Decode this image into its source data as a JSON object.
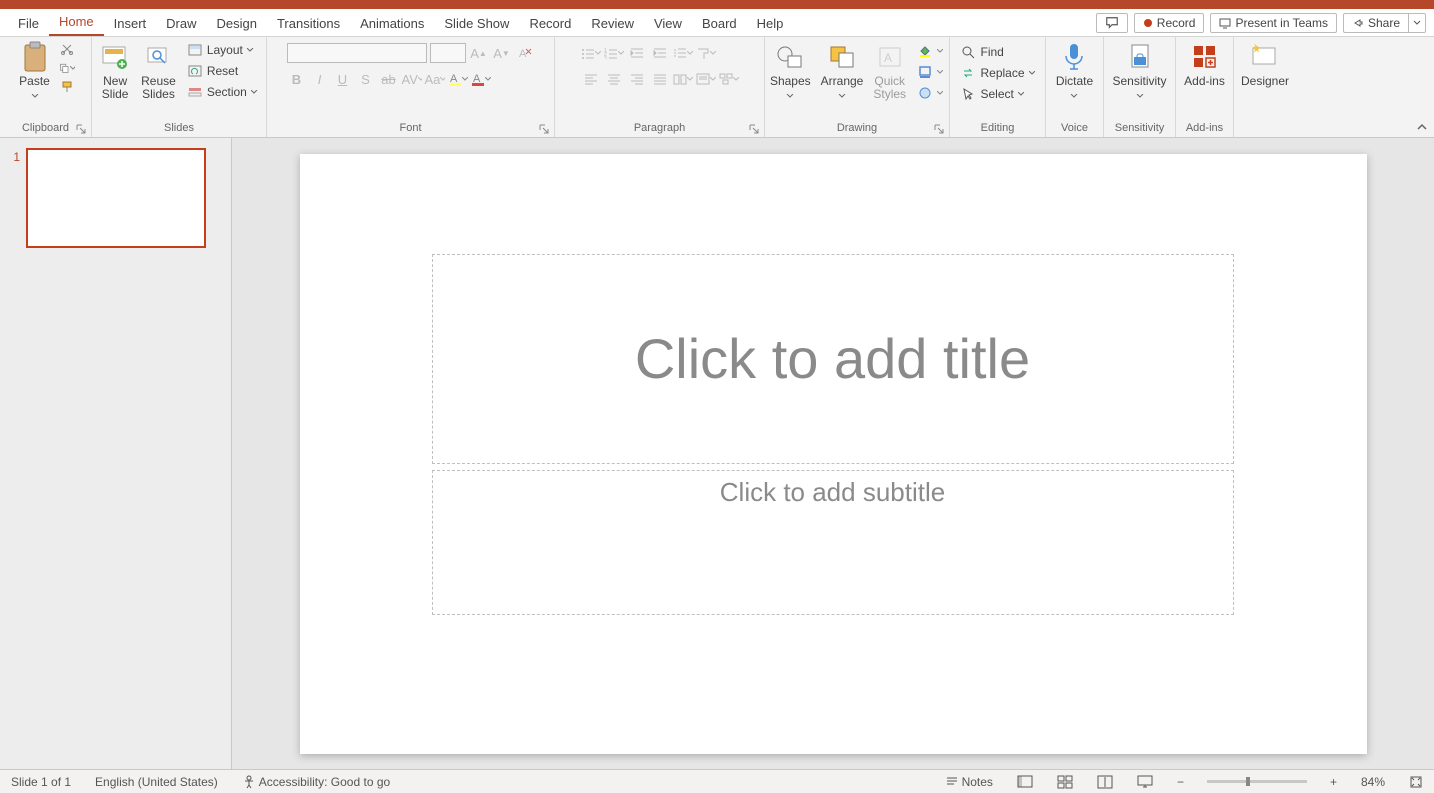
{
  "tabs": {
    "file": "File",
    "home": "Home",
    "insert": "Insert",
    "draw": "Draw",
    "design": "Design",
    "transitions": "Transitions",
    "animations": "Animations",
    "slideshow": "Slide Show",
    "record": "Record",
    "review": "Review",
    "view": "View",
    "board": "Board",
    "help": "Help"
  },
  "topright": {
    "record": "Record",
    "present": "Present in Teams",
    "share": "Share"
  },
  "ribbon": {
    "clipboard": {
      "label": "Clipboard",
      "paste": "Paste"
    },
    "slides": {
      "label": "Slides",
      "newslide": "New\nSlide",
      "reuse": "Reuse\nSlides",
      "layout": "Layout",
      "reset": "Reset",
      "section": "Section"
    },
    "font": {
      "label": "Font"
    },
    "paragraph": {
      "label": "Paragraph"
    },
    "drawing": {
      "label": "Drawing",
      "shapes": "Shapes",
      "arrange": "Arrange",
      "quick": "Quick\nStyles"
    },
    "editing": {
      "label": "Editing",
      "find": "Find",
      "replace": "Replace",
      "select": "Select"
    },
    "voice": {
      "label": "Voice",
      "dictate": "Dictate"
    },
    "sensitivity": {
      "label": "Sensitivity",
      "btn": "Sensitivity"
    },
    "addins": {
      "label": "Add-ins",
      "btn": "Add-ins"
    },
    "designer": {
      "label": "",
      "btn": "Designer"
    }
  },
  "thumbs": {
    "one": "1"
  },
  "slide": {
    "title_ph": "Click to add title",
    "sub_ph": "Click to add subtitle"
  },
  "status": {
    "slide": "Slide 1 of 1",
    "lang": "English (United States)",
    "a11y": "Accessibility: Good to go",
    "notes": "Notes",
    "zoom": "84%"
  }
}
